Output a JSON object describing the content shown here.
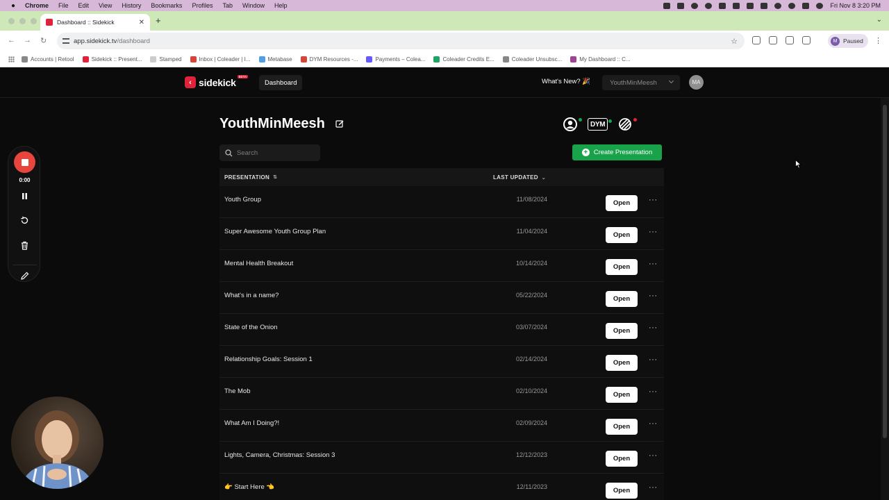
{
  "menubar": {
    "items": [
      "Chrome",
      "File",
      "Edit",
      "View",
      "History",
      "Bookmarks",
      "Profiles",
      "Tab",
      "Window",
      "Help"
    ],
    "clock": "Fri Nov 8  3:20 PM"
  },
  "browser": {
    "tab_title": "Dashboard :: Sidekick",
    "url_host": "app.sidekick.tv",
    "url_path": "/dashboard",
    "profile_initial": "M",
    "profile_status": "Paused",
    "bookmarks": [
      {
        "label": "Accounts | Retool",
        "color": "#888888"
      },
      {
        "label": "Sidekick :: Present...",
        "color": "#e0233b"
      },
      {
        "label": "Stamped",
        "color": "#cccccc"
      },
      {
        "label": "Inbox | Coleader | I...",
        "color": "#d44638"
      },
      {
        "label": "Metabase",
        "color": "#509ee3"
      },
      {
        "label": "DYM Resources -...",
        "color": "#d44638"
      },
      {
        "label": "Payments – Colea...",
        "color": "#635bff"
      },
      {
        "label": "Coleader Credits E...",
        "color": "#21a366"
      },
      {
        "label": "Coleader Unsubsc...",
        "color": "#888888"
      },
      {
        "label": "My Dashboard :: C...",
        "color": "#a0448f"
      }
    ]
  },
  "app": {
    "logo": "sidekick",
    "logo_badge": "BETA",
    "nav_dashboard": "Dashboard",
    "whats_new": "What's New? 🎉",
    "org_name": "YouthMinMeesh",
    "user_initials": "MA"
  },
  "page": {
    "title": "YouthMinMeesh",
    "dym_label": "DYM",
    "search_placeholder": "Search",
    "create_button": "Create Presentation",
    "status_colors": {
      "integration_a": "#18a34a",
      "dym": "#18a34a",
      "integration_c": "#e0233b"
    }
  },
  "table": {
    "col_presentation": "PRESENTATION",
    "col_last_updated": "LAST UPDATED",
    "open_label": "Open",
    "more_label": "···",
    "rows": [
      {
        "name": "Youth Group",
        "date": "11/08/2024"
      },
      {
        "name": "Super Awesome Youth Group Plan",
        "date": "11/04/2024"
      },
      {
        "name": "Mental Health Breakout",
        "date": "10/14/2024"
      },
      {
        "name": "What's in a name?",
        "date": "05/22/2024"
      },
      {
        "name": "State of the Onion",
        "date": "03/07/2024"
      },
      {
        "name": "Relationship Goals: Session 1",
        "date": "02/14/2024"
      },
      {
        "name": "The Mob",
        "date": "02/10/2024"
      },
      {
        "name": "What Am I Doing?!",
        "date": "02/09/2024"
      },
      {
        "name": "Lights, Camera, Christmas: Session 3",
        "date": "12/12/2023"
      },
      {
        "name": "👉 Start Here 👈",
        "date": "12/11/2023"
      }
    ]
  },
  "recorder": {
    "time": "0:00"
  }
}
